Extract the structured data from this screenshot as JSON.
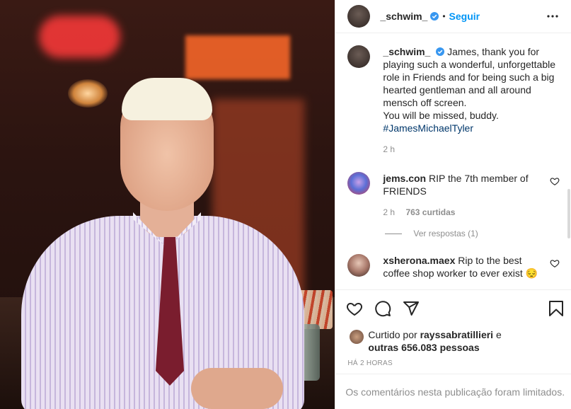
{
  "header": {
    "username": "_schwim_",
    "separator": "•",
    "follow_label": "Seguir"
  },
  "caption": {
    "username": "_schwim_",
    "lines": [
      "James, thank you for playing such a wonderful, unforgettable role in Friends and for being such a big hearted gentleman and all around mensch off screen.",
      "You will be missed, buddy."
    ],
    "hashtag": "#JamesMichaelTyler",
    "time": "2 h"
  },
  "comments": [
    {
      "username": "jems.con",
      "text": "RIP the 7th member of FRIENDS",
      "time": "2 h",
      "likes": "763 curtidas",
      "replies": "Ver respostas (1)"
    },
    {
      "username": "xsherona.maex",
      "text": "Rip to the best coffee shop worker to ever exist 😔"
    }
  ],
  "likes": {
    "prefix": "Curtido por",
    "user": "rayssabratillieri",
    "conjunction": "e",
    "rest": "outras 656.083 pessoas"
  },
  "timestamp": "HÁ 2 HORAS",
  "limited_comments": "Os comentários nesta publicação foram limitados.",
  "colors": {
    "follow": "#0095f6",
    "verified": "#3897f0",
    "hashtag": "#00376b",
    "muted": "#8e8e8e"
  },
  "icons": [
    "more-options-icon",
    "verified-icon",
    "heart-icon",
    "comment-icon",
    "share-icon",
    "bookmark-icon"
  ]
}
